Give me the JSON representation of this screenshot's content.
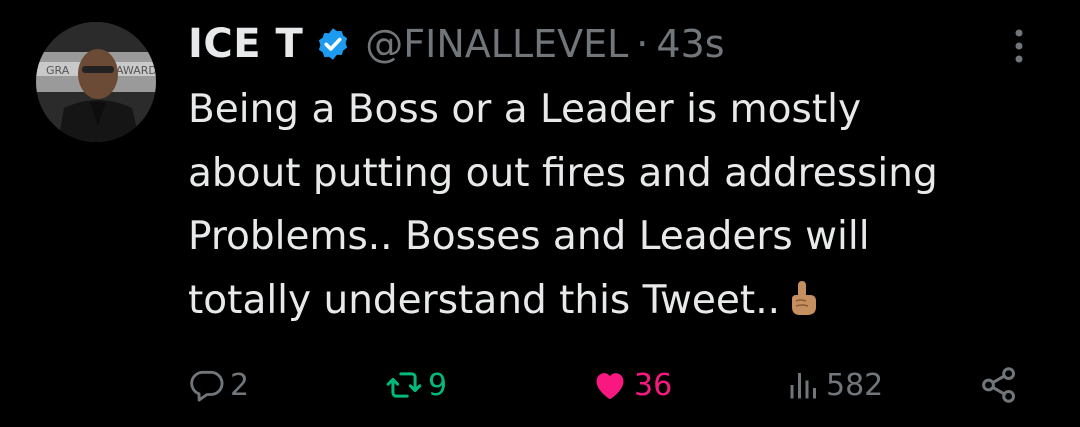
{
  "tweet": {
    "author_name": "ICE T",
    "handle": "@FINALLEVEL",
    "separator": "·",
    "time": "43s",
    "text_lines": [
      "Being a Boss or a Leader is mostly",
      "about putting out fires and addressing",
      "Problems.. Bosses and Leaders will",
      "totally understand this Tweet.."
    ],
    "emoji": "point-up-emoji",
    "avatar_banner_text_left": "GRA",
    "avatar_banner_text_right": "AWARD"
  },
  "actions": {
    "replies": "2",
    "retweets": "9",
    "likes": "36",
    "views": "582"
  },
  "colors": {
    "background": "#000000",
    "text": "#e7e9ea",
    "muted": "#71767b",
    "verified_blue": "#1d9bf0",
    "retweet_green": "#00ba7c",
    "like_pink": "#f91880"
  }
}
